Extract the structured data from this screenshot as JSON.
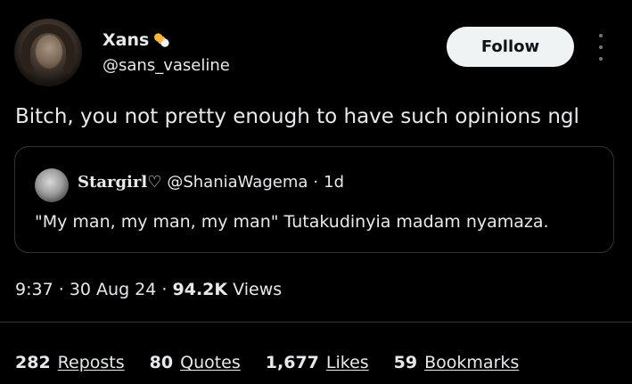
{
  "post": {
    "author": {
      "display_name": "Xans",
      "name_emoji_icon": "pill-icon",
      "handle": "@sans_vaseline"
    },
    "follow_label": "Follow",
    "more_icon": "more-options-icon",
    "text": "Bitch, you not pretty enough to have such opinions ngl",
    "quote": {
      "display_name": "Stargirl♡",
      "handle": "@ShaniaWagema",
      "separator": "·",
      "age": "1d",
      "text": "\"My man, my man, my man\" Tutakudinyia madam nyamaza."
    },
    "meta": {
      "time": "9:37",
      "separator1": "·",
      "date": "30 Aug 24",
      "separator2": "·",
      "views_count": "94.2K",
      "views_label": "Views"
    },
    "stats": {
      "reposts_count": "282",
      "reposts_label": "Reposts",
      "quotes_count": "80",
      "quotes_label": "Quotes",
      "likes_count": "1,677",
      "likes_label": "Likes",
      "bookmarks_count": "59",
      "bookmarks_label": "Bookmarks"
    }
  },
  "colors": {
    "background": "#000000",
    "text": "#e7e9ea",
    "secondary": "#71767b",
    "border": "#2f3336",
    "follow_bg": "#eff3f4"
  }
}
